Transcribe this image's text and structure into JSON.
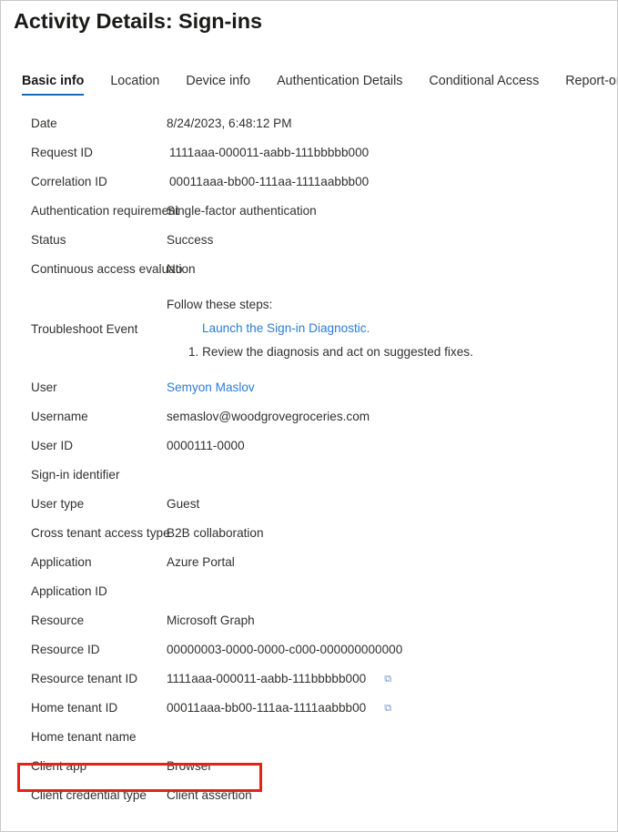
{
  "header": {
    "title": "Activity Details: Sign-ins"
  },
  "tabs": [
    {
      "label": "Basic info",
      "active": true
    },
    {
      "label": "Location",
      "active": false
    },
    {
      "label": "Device info",
      "active": false
    },
    {
      "label": "Authentication Details",
      "active": false
    },
    {
      "label": "Conditional Access",
      "active": false
    },
    {
      "label": "Report-only",
      "active": false
    }
  ],
  "details": {
    "date": {
      "label": "Date",
      "value": "8/24/2023, 6:48:12 PM"
    },
    "request_id": {
      "label": "Request ID",
      "value": "1111aaa-000011-aabb-111bbbbb000"
    },
    "correlation_id": {
      "label": "Correlation ID",
      "value": "00011aaa-bb00-111aa-1111aabbb00"
    },
    "auth_requirement": {
      "label": "Authentication requirement",
      "value": "Single-factor authentication"
    },
    "status": {
      "label": "Status",
      "value": "Success"
    },
    "cae": {
      "label": "Continuous access evaluation",
      "value": "No"
    },
    "troubleshoot": {
      "label": "Troubleshoot Event",
      "intro": "Follow these steps:",
      "link": "Launch the Sign-in Diagnostic.",
      "step": "1. Review the diagnosis and act on suggested fixes."
    },
    "user": {
      "label": "User",
      "value": "Semyon Maslov"
    },
    "username": {
      "label": "Username",
      "value": "semaslov@woodgrovegroceries.com"
    },
    "user_id": {
      "label": "User ID",
      "value": "0000111-0000"
    },
    "signin_identifier": {
      "label": "Sign-in identifier",
      "value": ""
    },
    "user_type": {
      "label": "User type",
      "value": "Guest"
    },
    "cross_tenant_access_type": {
      "label": "Cross tenant access type",
      "value": "B2B collaboration"
    },
    "application": {
      "label": "Application",
      "value": "Azure Portal"
    },
    "application_id": {
      "label": "Application ID",
      "value": ""
    },
    "resource": {
      "label": "Resource",
      "value": "Microsoft Graph"
    },
    "resource_id": {
      "label": "Resource ID",
      "value": "00000003-0000-0000-c000-000000000000"
    },
    "resource_tenant_id": {
      "label": "Resource tenant ID",
      "value": "1111aaa-000011-aabb-111bbbbb000"
    },
    "home_tenant_id": {
      "label": "Home tenant ID",
      "value": "00011aaa-bb00-111aa-1111aabbb00"
    },
    "home_tenant_name": {
      "label": "Home tenant name",
      "value": ""
    },
    "client_app": {
      "label": "Client app",
      "value": "Browser"
    },
    "client_credential_type": {
      "label": "Client credential type",
      "value": "Client assertion"
    }
  },
  "colors": {
    "accent": "#0f6cbd",
    "link": "#2b7cd3",
    "annotation": "#e8201c",
    "text": "#323130",
    "border": "#c8c8c8"
  }
}
